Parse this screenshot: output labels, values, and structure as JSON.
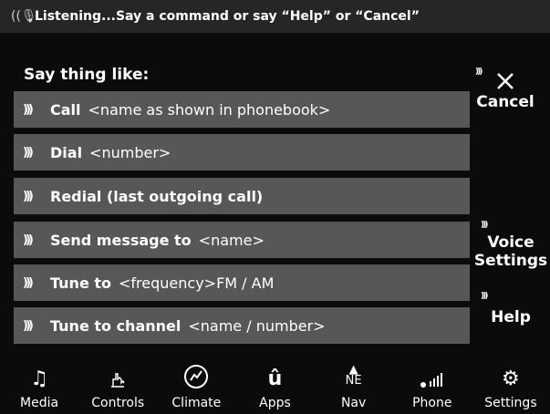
{
  "status": {
    "icon": "voice-listening-icon",
    "text": "Listening...Say a command or say “Help” or “Cancel”"
  },
  "prompt_title": "Say thing like:",
  "commands": [
    {
      "label": "Call",
      "arg": "<name as shown in phonebook>"
    },
    {
      "label": "Dial",
      "arg": "<number>"
    },
    {
      "label": "Redial (last outgoing call)",
      "arg": ""
    },
    {
      "label": "Send message to",
      "arg": "<name>"
    },
    {
      "label": "Tune to",
      "arg": "<frequency>FM / AM"
    },
    {
      "label": "Tune to channel",
      "arg": "<name / number>"
    }
  ],
  "side": {
    "cancel": "Cancel",
    "voice_line1": "Voice",
    "voice_line2": "Settings",
    "help": "Help"
  },
  "nav": [
    {
      "label": "Media",
      "icon": "music-note-icon"
    },
    {
      "label": "Controls",
      "icon": "hand-controls-icon"
    },
    {
      "label": "Climate",
      "icon": "climate-icon"
    },
    {
      "label": "Apps",
      "icon": "apps-icon"
    },
    {
      "label": "Nav",
      "icon": "compass-ne-icon"
    },
    {
      "label": "Phone",
      "icon": "phone-signal-icon"
    },
    {
      "label": "Settings",
      "icon": "gear-icon"
    }
  ]
}
